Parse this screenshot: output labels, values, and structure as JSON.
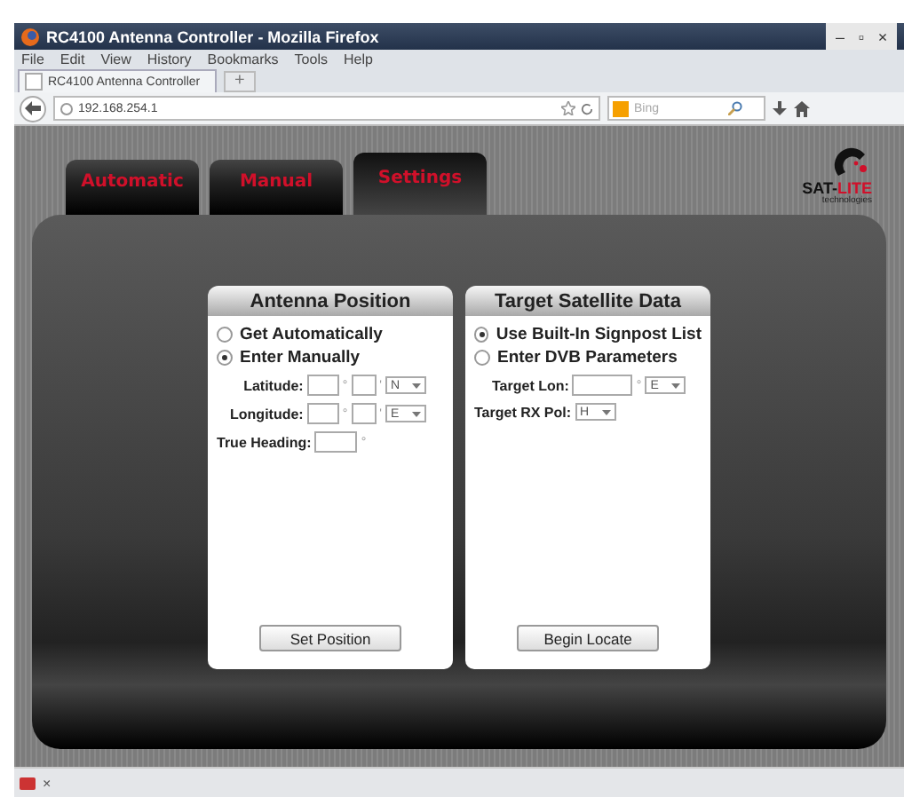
{
  "window": {
    "title": "RC4100 Antenna Controller - Mozilla Firefox",
    "controls": [
      "–",
      "▫",
      "×"
    ]
  },
  "menu": [
    "File",
    "Edit",
    "View",
    "History",
    "Bookmarks",
    "Tools",
    "Help"
  ],
  "browser_tab": {
    "title": "RC4100 Antenna Controller",
    "new_tab": "+"
  },
  "address_bar": {
    "url": "192.168.254.1"
  },
  "search": {
    "placeholder": "Bing"
  },
  "tabs": [
    {
      "label": "Automatic",
      "selected": false
    },
    {
      "label": "Manual",
      "selected": false
    },
    {
      "label": "Settings",
      "selected": true
    }
  ],
  "logo": {
    "words": [
      "SAT-",
      "LITE"
    ],
    "tagline": "technologies"
  },
  "antenna_position": {
    "title": "Antenna Position",
    "options": [
      {
        "label": "Get Automatically",
        "selected": false
      },
      {
        "label": "Enter Manually",
        "selected": true
      }
    ],
    "coordinates": [
      {
        "label": "Latitude:",
        "degree": "°",
        "minute": "'",
        "hemisphere": "N"
      },
      {
        "label": "Longitude:",
        "degree": "°",
        "minute": "'",
        "hemisphere": "E"
      }
    ],
    "heading": {
      "label": "True Heading:",
      "degree": "°"
    },
    "button": "Set Position"
  },
  "target_satellite": {
    "title": "Target Satellite Data",
    "options": [
      {
        "label": "Use Built-In Signpost List",
        "selected": true
      },
      {
        "label": "Enter DVB Parameters",
        "selected": false
      }
    ],
    "longitude": {
      "label": "Target Lon:",
      "degree": "°",
      "hemisphere": "E"
    },
    "polarization": {
      "label": "Target RX Pol:",
      "value": "H"
    },
    "button": "Begin Locate"
  },
  "status_bar": {
    "close": "×"
  }
}
